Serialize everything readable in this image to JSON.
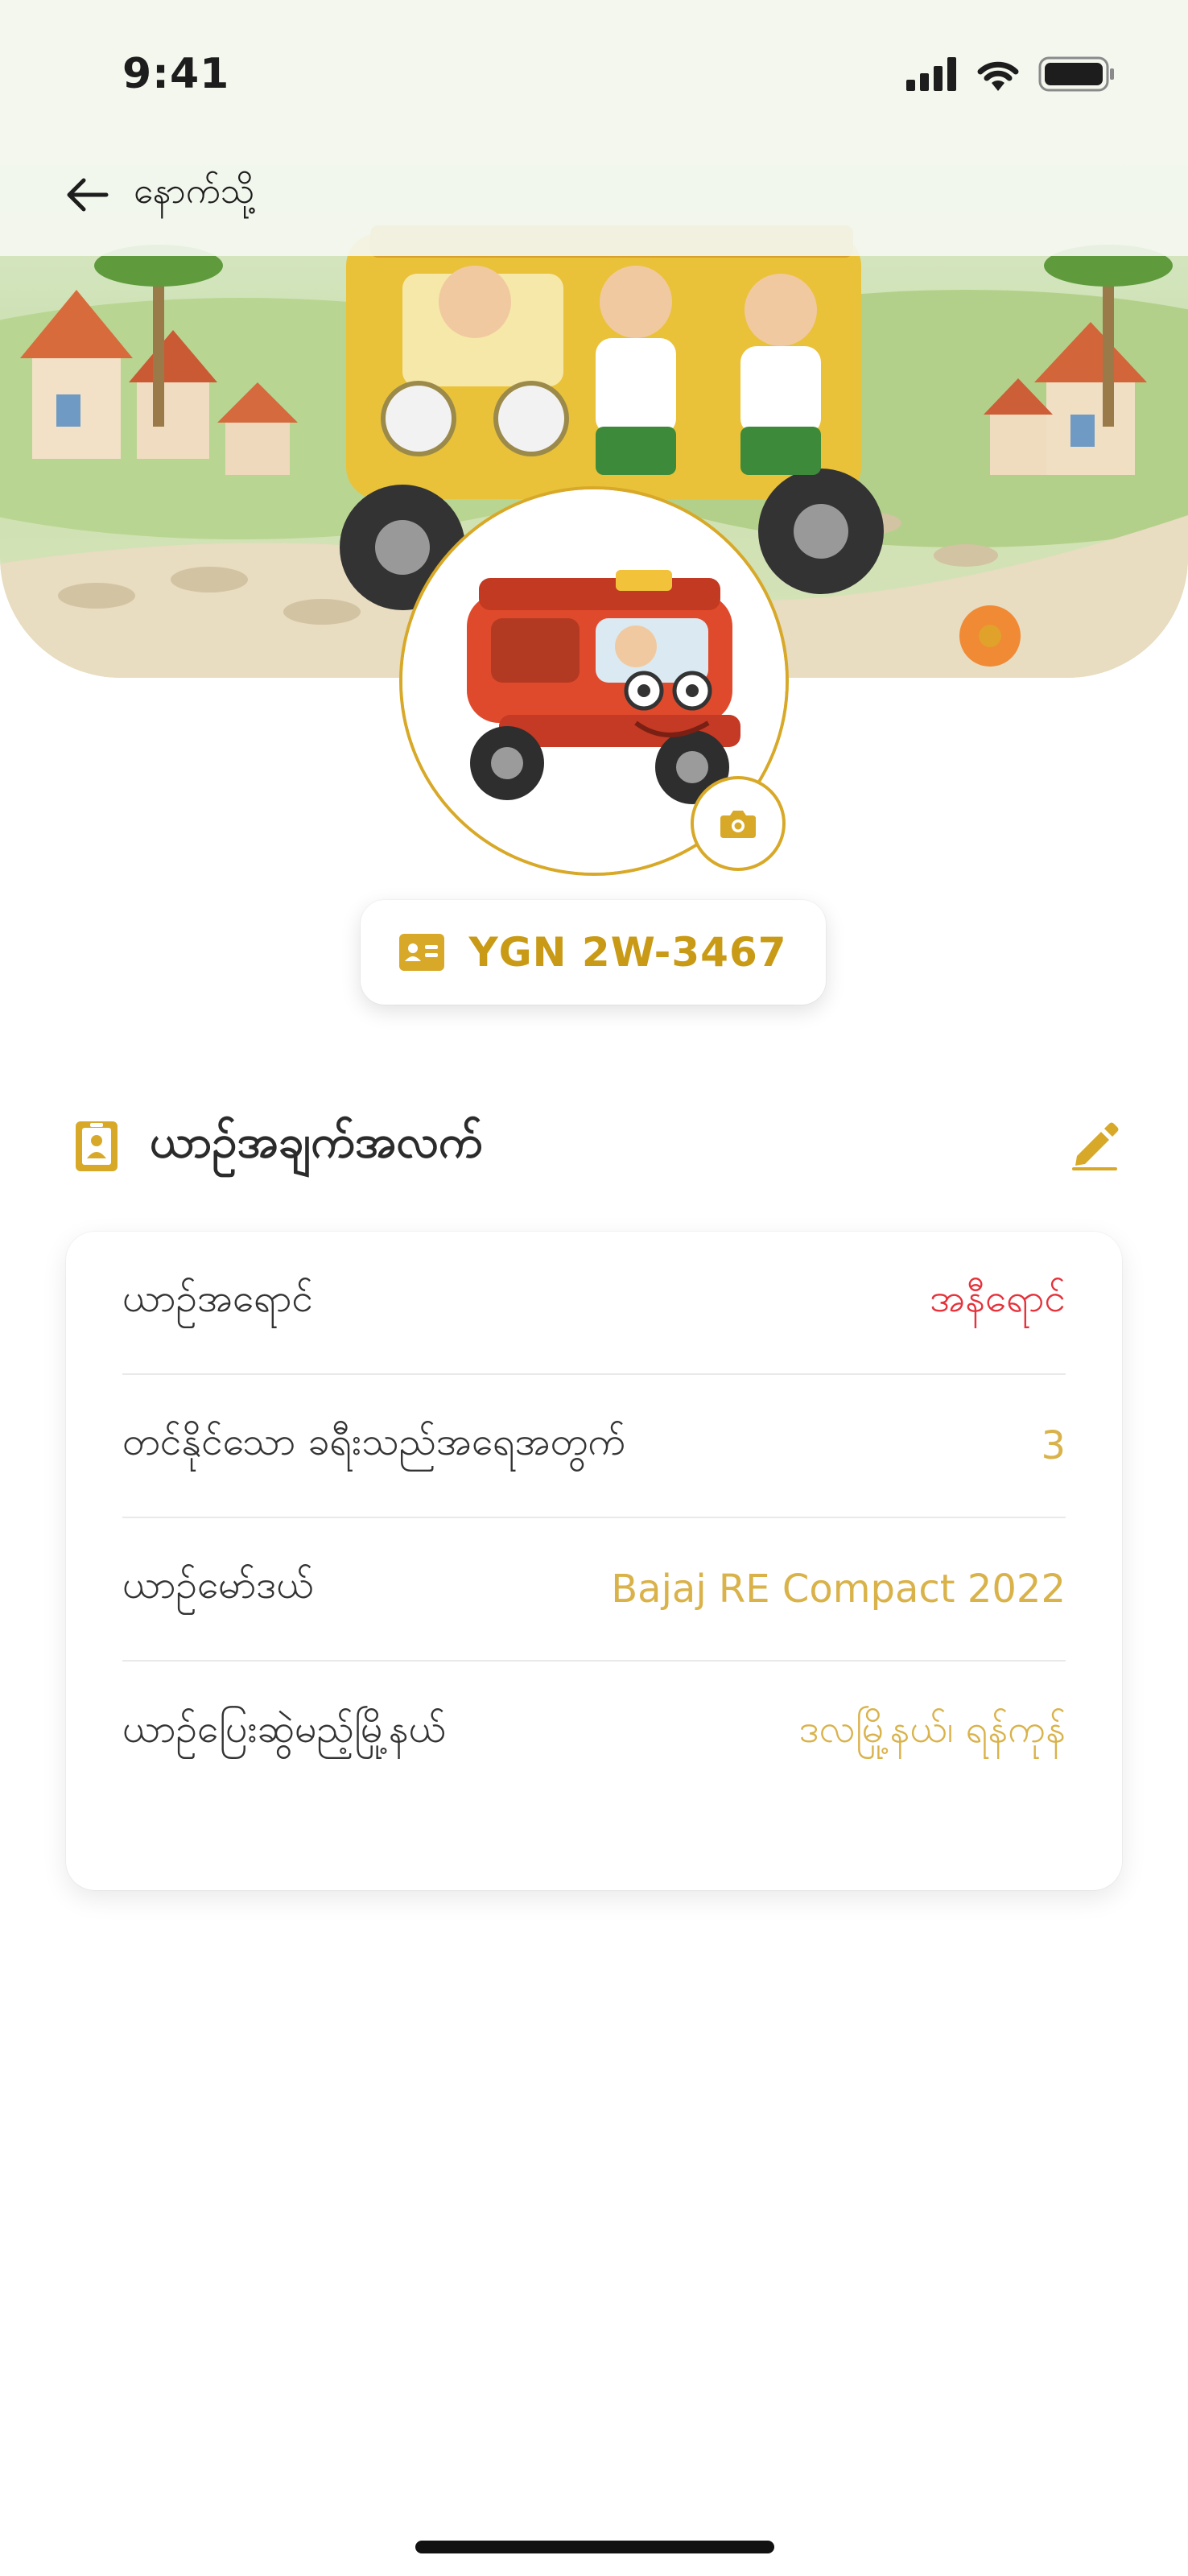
{
  "status_bar": {
    "time": "9:41"
  },
  "nav": {
    "back_label": "နောက်သို့",
    "back_icon": "arrow-left-icon"
  },
  "vehicle": {
    "plate": "YGN 2W-3467"
  },
  "vehicle_info": {
    "title": "ယာဉ်အချက်အလက်",
    "rows": [
      {
        "label": "ယာဉ်အရောင်",
        "value": "အနီရောင်"
      },
      {
        "label": "တင်နိုင်သော ခရီးသည်အရေအတွက်",
        "value": "3"
      },
      {
        "label": "ယာဉ်မော်ဒယ်",
        "value": "Bajaj RE Compact 2022"
      },
      {
        "label": "ယာဉ်ပြေးဆွဲမည့်မြို့နယ်",
        "value": "ဒလမြို့နယ်၊ ရန်ကုန်"
      }
    ]
  },
  "colors": {
    "accent": "#d8a928",
    "accent_text": "#c99a16",
    "value_text": "#d9b24a",
    "danger": "#e5323b"
  }
}
